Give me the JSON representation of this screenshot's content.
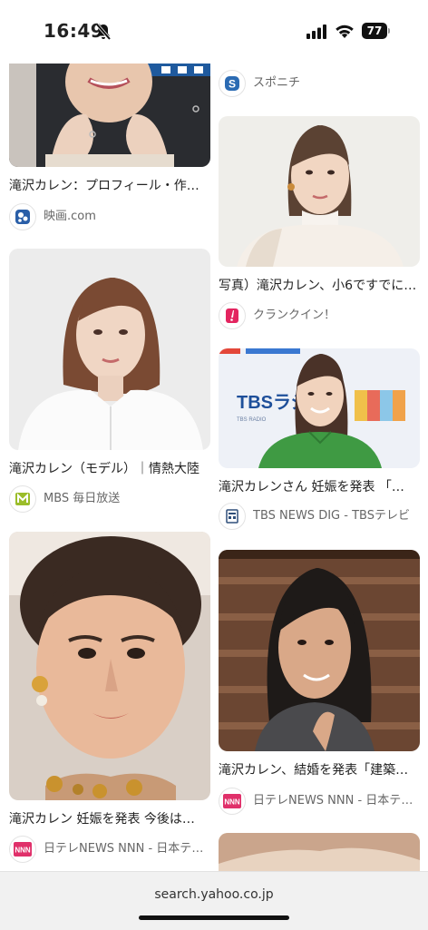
{
  "status_bar": {
    "time": "16:49",
    "battery": "77"
  },
  "results": {
    "left": [
      {
        "title": "滝沢カレン：プロフィール・作品情報",
        "source": "映画.com",
        "icon": "eiga-com-icon",
        "icon_text": "e",
        "icon_color": "#2a5fa8"
      },
      {
        "title": "滝沢カレン（モデル）｜情熱大陸",
        "source": "MBS 毎日放送",
        "icon": "mbs-icon",
        "icon_text": "M",
        "icon_color": "#9bbd2a"
      },
      {
        "title": "滝沢カレン 妊娠を発表 今後は…",
        "source": "日テレNEWS NNN - 日本テレビ",
        "icon": "nnn-icon",
        "icon_text": "NNN",
        "icon_color": "#e0306a"
      },
      {
        "title": "",
        "source": "",
        "icon": "",
        "icon_text": "",
        "icon_color": ""
      }
    ],
    "right": [
      {
        "title": "",
        "source": "スポニチ",
        "icon": "sponichi-icon",
        "icon_text": "S",
        "icon_color": "#2b6bb3"
      },
      {
        "title": "写真）滝沢カレン、小6ですでに…",
        "source": "クランクイン！",
        "icon": "crankin-icon",
        "icon_text": "!",
        "icon_color": "#e3245f"
      },
      {
        "title": "滝沢カレンさん 妊娠を発表 「…",
        "source": "TBS NEWS DIG - TBSテレビ",
        "icon": "tbs-icon",
        "icon_text": "▦",
        "icon_color": "#2f4f7a"
      },
      {
        "title": "滝沢カレン、結婚を発表「建築…",
        "source": "日テレNEWS NNN - 日本テレビ",
        "icon": "nnn-icon",
        "icon_text": "NNN",
        "icon_color": "#e0306a"
      },
      {
        "title": "",
        "source": "",
        "icon": "",
        "icon_text": "",
        "icon_color": ""
      }
    ]
  },
  "url_bar": {
    "url": "search.yahoo.co.jp"
  }
}
